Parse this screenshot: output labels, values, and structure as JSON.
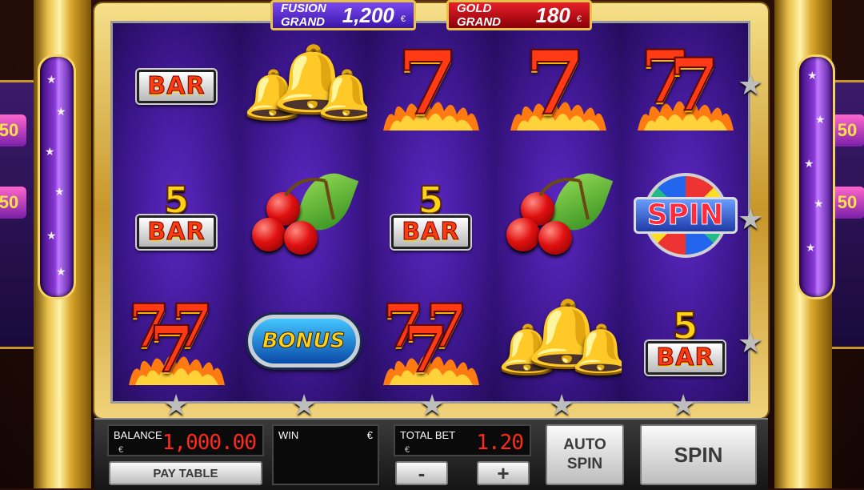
{
  "jackpots": {
    "fusion": {
      "name": "FUSION GRAND",
      "amount": "1,200",
      "currency": "€"
    },
    "gold": {
      "name": "GOLD GRAND",
      "amount": "180",
      "currency": "€"
    }
  },
  "reels": [
    [
      {
        "symbol": "bar",
        "label": "BAR"
      },
      {
        "symbol": "five-bar",
        "top": "5",
        "label": "BAR"
      },
      {
        "symbol": "triple-seven",
        "label": "7"
      }
    ],
    [
      {
        "symbol": "bell"
      },
      {
        "symbol": "cherries"
      },
      {
        "symbol": "bonus",
        "label": "BONUS"
      }
    ],
    [
      {
        "symbol": "seven",
        "label": "7"
      },
      {
        "symbol": "five-bar",
        "top": "5",
        "label": "BAR"
      },
      {
        "symbol": "triple-seven",
        "label": "7"
      }
    ],
    [
      {
        "symbol": "seven",
        "label": "7"
      },
      {
        "symbol": "cherries"
      },
      {
        "symbol": "bell"
      }
    ],
    [
      {
        "symbol": "double-seven",
        "label": "7"
      },
      {
        "symbol": "spin",
        "label": "SPIN"
      },
      {
        "symbol": "five-bar",
        "top": "5",
        "label": "BAR"
      }
    ]
  ],
  "panel": {
    "balance_label": "BALANCE",
    "balance_currency": "€",
    "balance_value": "1,000.00",
    "win_label": "WIN",
    "win_currency": "€",
    "win_value": "",
    "total_bet_label": "TOTAL BET",
    "total_bet_currency": "€",
    "total_bet_value": "1.20",
    "pay_table": "PAY TABLE",
    "minus": "-",
    "plus": "+",
    "auto_spin_1": "AUTO",
    "auto_spin_2": "SPIN",
    "spin": "SPIN"
  },
  "side": {
    "left_badge": "50",
    "right_badge": "50"
  },
  "colors": {
    "reel_bg": "#3b168a",
    "frame_gold": "#e8c14a",
    "lcd_red": "#ff2a1a",
    "fusion": "#5a2ad0",
    "gold": "#d0101a"
  },
  "icons": {
    "payline_marker": "star-icon"
  }
}
